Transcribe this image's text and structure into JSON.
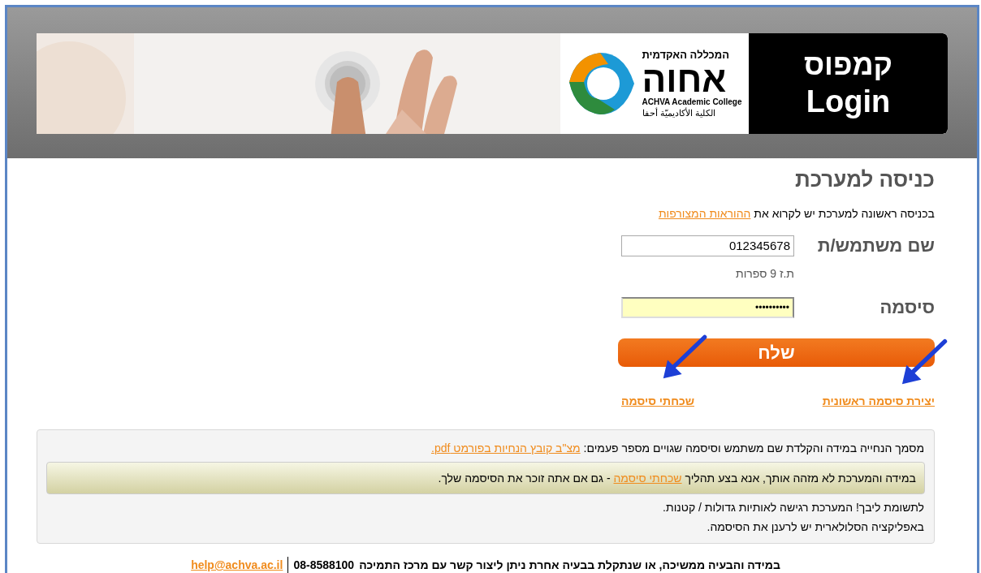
{
  "banner": {
    "college_tagline": "המכללה האקדמית",
    "college_name": "אחוה",
    "college_english": "ACHVA Academic College",
    "college_arabic": "الكلية الأكاديميّة أحفا",
    "campus": "קמפוס",
    "login": "Login"
  },
  "form": {
    "title": "כניסה למערכת",
    "intro": "בכניסה ראשונה למערכת יש לקרוא את",
    "intro_link": "ההוראות המצורפות",
    "username": {
      "label": "שם משתמש/ת",
      "value": "012345678",
      "hint": "ת.ז 9 ספרות"
    },
    "password": {
      "label": "סיסמה",
      "value": "••••••••••"
    },
    "submit": "שלח",
    "links": [
      {
        "text": "יצירת סיסמה ראשונית",
        "annotated": true
      },
      {
        "text": "שכחתי סיסמה",
        "annotated": true
      }
    ]
  },
  "notice": {
    "line_1": "מסמך הנחייה במידה והקלדת שם משתמש וסיסמה שגויים מספר פעמים:",
    "line_1_link": "מצ\"ב קובץ הנחיות בפורמט pdf.",
    "highlight_before": "במידה והמערכת לא מזהה אותך, אנא בצע תהליך",
    "highlight_link": "שכחתי סיסמה",
    "highlight_after": "- גם אם אתה זוכר את הסיסמה שלך.",
    "lines": [
      "לתשומת ליבך! המערכת רגישה לאותיות גדולות / קטנות.",
      "באפליקציה הסלולארית יש לרענן את הסיסמה."
    ]
  },
  "footer": {
    "text": "במידה והבעיה ממשיכה, או שנתקלת בבעיה אחרת ניתן ליצור קשר עם מרכז התמיכה",
    "phone": "08-8588100",
    "email": "help@achva.ac.il"
  }
}
